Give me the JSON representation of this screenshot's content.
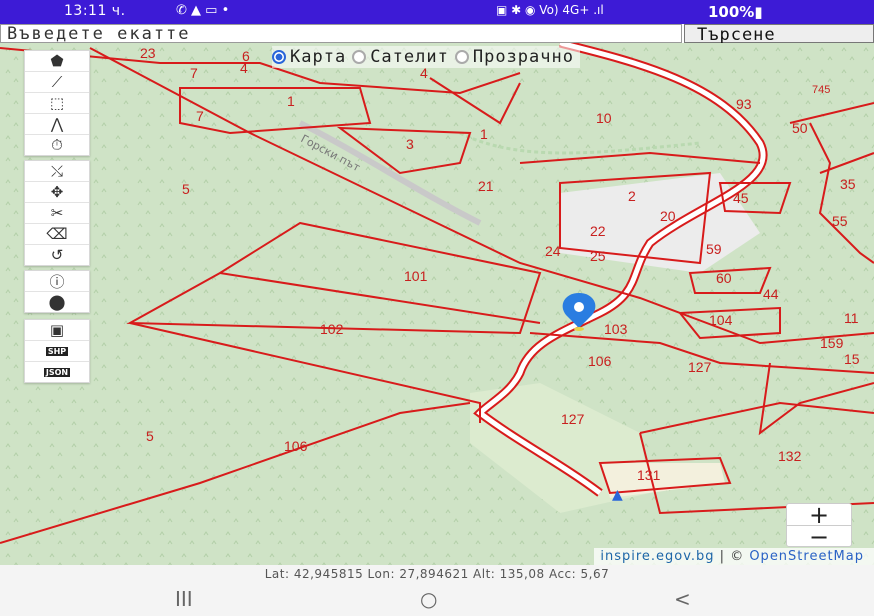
{
  "status": {
    "time": "13:11 ч.",
    "icons_left": "✆ ▲ ▭ •",
    "icons_right": "▣ ✱ ◉ Vo) 4G+ .ıl",
    "battery": "100%▮"
  },
  "search": {
    "placeholder": "Въведете екатте",
    "button": "Търсене"
  },
  "layers": {
    "options": [
      "Карта",
      "Сателит",
      "Прозрачно"
    ],
    "selected": "Карта"
  },
  "toolbar": {
    "group1": [
      "location-pin-icon",
      "line-icon",
      "rectangle-icon",
      "polygon-icon",
      "timer-icon"
    ],
    "group2": [
      "pointer-icon",
      "move-icon",
      "scissors-icon",
      "eraser-icon",
      "undo-icon"
    ],
    "group3": [
      "info-icon",
      "locate-icon"
    ],
    "group4": [
      "save-icon",
      "export-shp-icon",
      "export-json-icon"
    ],
    "export_shp": "SHP",
    "export_json": "JSON"
  },
  "map": {
    "parcel_labels": [
      "23",
      "7",
      "4",
      "6",
      "4",
      "1",
      "7",
      "3",
      "10",
      "93",
      "745",
      "50",
      "5",
      "21",
      "2",
      "45",
      "35",
      "55",
      "22",
      "25",
      "59",
      "60",
      "44",
      "101",
      "102",
      "103",
      "104",
      "11",
      "159",
      "106",
      "127",
      "15",
      "5",
      "106",
      "127",
      "132",
      "131",
      "24",
      "20",
      "1"
    ],
    "road_labels": [
      "Горски път"
    ],
    "colors": {
      "parcel_line": "#d81b1b",
      "forest": "#cfe3c6",
      "road": "#ffffff",
      "marker": "#2a7de1"
    }
  },
  "zoom": {
    "in": "+",
    "out": "−"
  },
  "attribution": {
    "source": "inspire.egov.bg",
    "separator": " | © ",
    "osm": "OpenStreetMap"
  },
  "coords": "Lat: 42,945815 Lon: 27,894621 Alt: 135,08 Acc: 5,67",
  "navbar": {
    "recent": "III",
    "home": "○",
    "back": "<"
  }
}
